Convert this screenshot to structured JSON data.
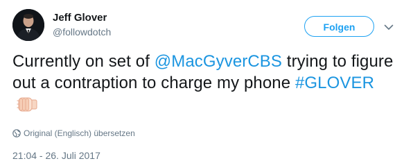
{
  "user": {
    "display_name": "Jeff Glover",
    "handle": "@followdotch"
  },
  "follow_button": {
    "label": "Folgen"
  },
  "tweet": {
    "text_part1": "Currently on set of ",
    "mention": "@MacGyverCBS",
    "text_part2": " trying to figure out a contraption to charge my phone ",
    "hashtag": "#GLOVER",
    "emoji": "fist-bump-emoji"
  },
  "translate": {
    "label": "Original (Englisch) übersetzen",
    "icon": "globe-icon"
  },
  "timestamp": "21:04 - 26. Juli 2017",
  "colors": {
    "link": "#1b95e0",
    "button": "#1da1f2",
    "secondary_text": "#657786",
    "primary_text": "#14171a"
  }
}
